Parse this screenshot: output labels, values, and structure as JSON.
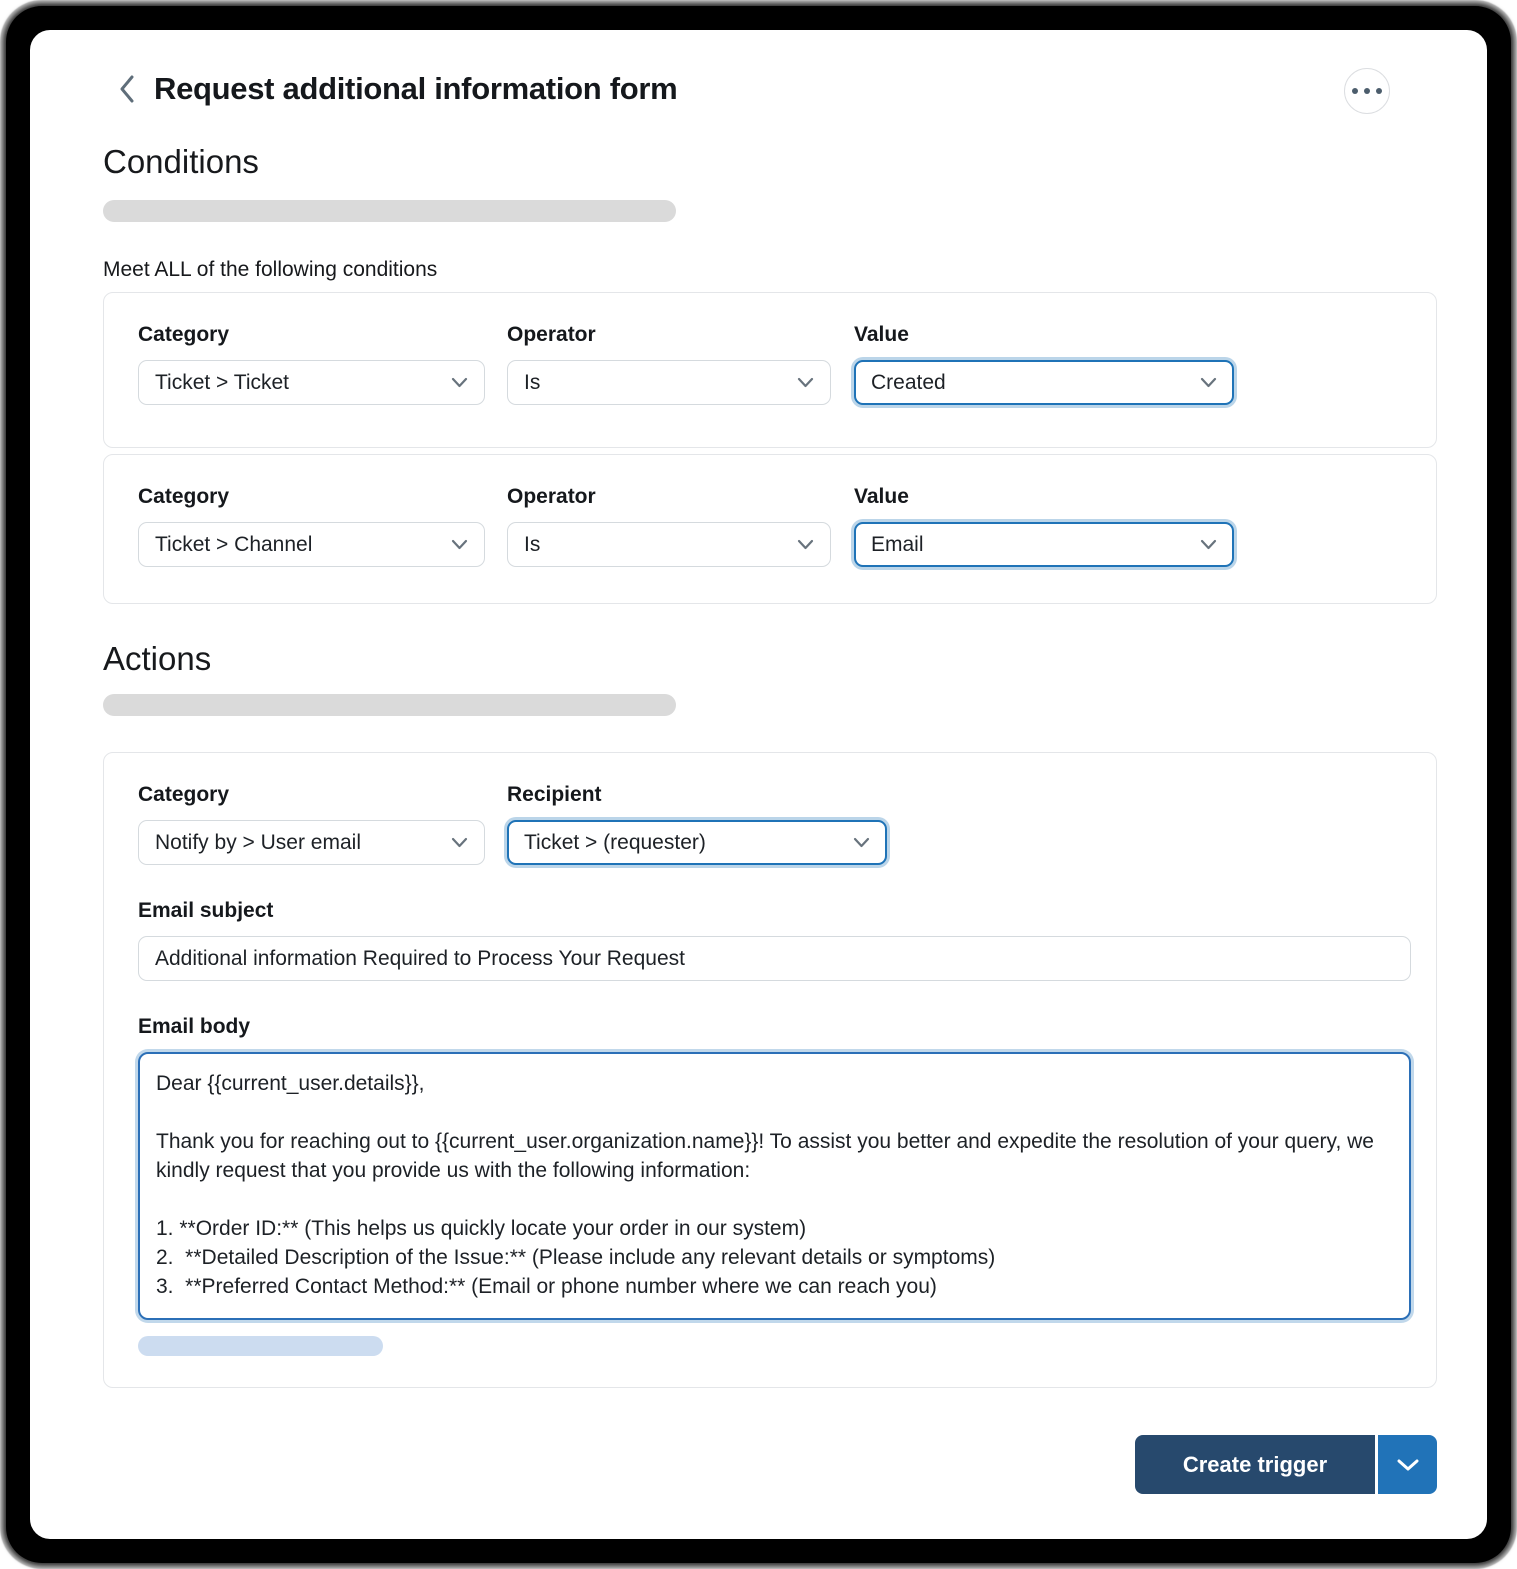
{
  "header": {
    "title": "Request additional information form",
    "back_icon": "chevron-left",
    "menu_icon": "ellipsis"
  },
  "conditions": {
    "heading": "Conditions",
    "subheading": "Meet ALL of the following conditions",
    "rows": [
      {
        "category_label": "Category",
        "category_value": "Ticket > Ticket",
        "operator_label": "Operator",
        "operator_value": "Is",
        "value_label": "Value",
        "value_value": "Created"
      },
      {
        "category_label": "Category",
        "category_value": "Ticket > Channel",
        "operator_label": "Operator",
        "operator_value": "Is",
        "value_label": "Value",
        "value_value": "Email"
      }
    ]
  },
  "actions": {
    "heading": "Actions",
    "category_label": "Category",
    "category_value": "Notify by > User email",
    "recipient_label": "Recipient",
    "recipient_value": "Ticket > (requester)",
    "email_subject_label": "Email subject",
    "email_subject_value": "Additional information Required to Process Your Request",
    "email_body_label": "Email body",
    "email_body_value": "Dear {{current_user.details}},\n\nThank you for reaching out to {{current_user.organization.name}}! To assist you better and expedite the resolution of your query, we kindly request that you provide us with the following information:\n\n1. **Order ID:** (This helps us quickly locate your order in our system)\n2.  **Detailed Description of the Issue:** (Please include any relevant details or symptoms)\n3.  **Preferred Contact Method:** (Email or phone number where we can reach you)"
  },
  "footer": {
    "create_button_label": "Create trigger",
    "caret_icon": "chevron-down"
  },
  "colors": {
    "accent_blue": "#1f73b7",
    "button_navy": "#27496d",
    "button_blue": "#2173b8",
    "focus_ring": "rgba(31,115,183,0.3)",
    "skeleton_gray": "#dadada",
    "skeleton_blue": "#ccdcf0"
  }
}
